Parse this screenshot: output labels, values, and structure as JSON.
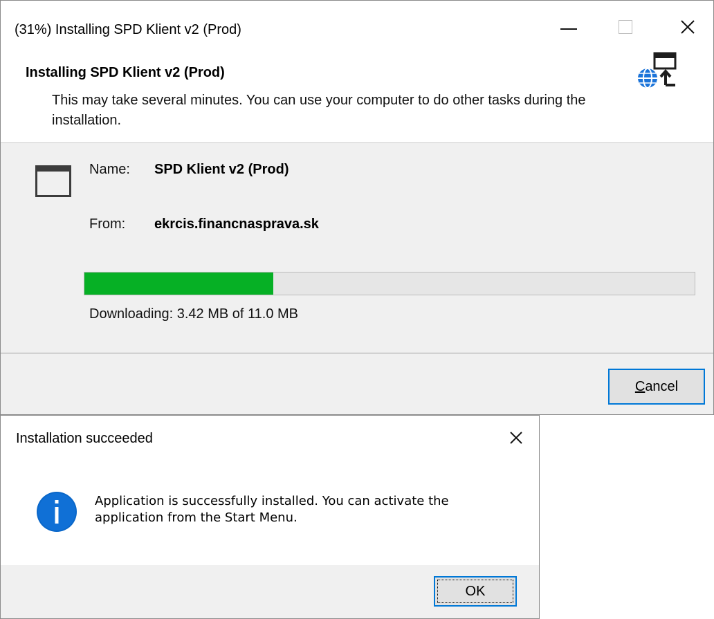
{
  "installer": {
    "window_title": "(31%) Installing SPD Klient v2 (Prod)",
    "header_title": "Installing SPD Klient v2 (Prod)",
    "header_description": "This may take several minutes. You can use your computer to do other tasks during the installation.",
    "name_label": "Name:",
    "name_value": "SPD Klient v2 (Prod)",
    "from_label": "From:",
    "from_value": "ekrcis.financnasprava.sk",
    "progress_percent": 31,
    "progress_fraction": 0.31,
    "status_text": "Downloading: 3.42 MB of 11.0 MB",
    "cancel_label_accel": "C",
    "cancel_label_rest": "ancel",
    "icons": {
      "minimize": "minimize-icon",
      "maximize": "maximize-icon",
      "close": "close-icon",
      "header": "globe-deploy-icon",
      "app": "application-window-icon"
    },
    "colors": {
      "progress_fill": "#06b025",
      "focus_border": "#0078d7",
      "panel_bg": "#f0f0f0"
    }
  },
  "success_dialog": {
    "window_title": "Installation succeeded",
    "message": "Application is successfully installed. You can activate the application from the Start Menu.",
    "ok_label": "OK",
    "icons": {
      "close": "close-icon",
      "info": "information-icon"
    },
    "colors": {
      "info_icon": "#0a67c9"
    }
  }
}
